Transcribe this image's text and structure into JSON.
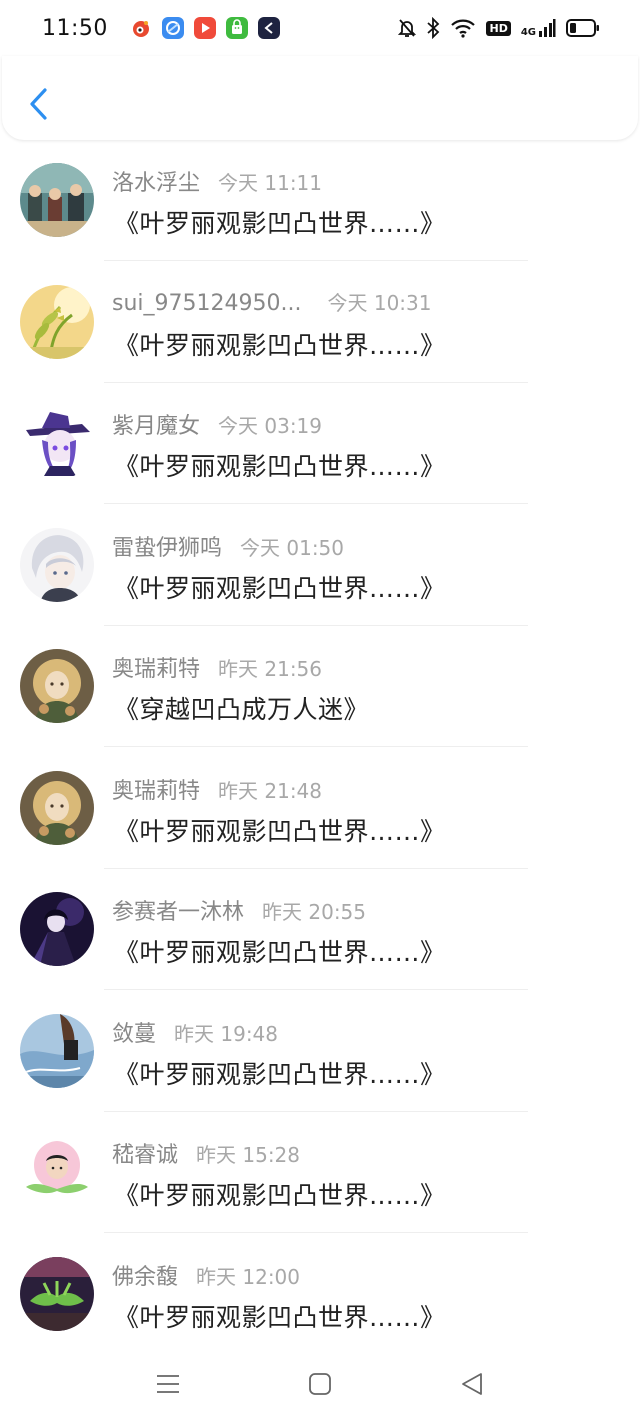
{
  "status_bar": {
    "time": "11:50",
    "notification_apps": [
      {
        "icon": "weibo-icon",
        "color": "#e8492f"
      },
      {
        "icon": "browser-icon",
        "color": "#3b8cf0"
      },
      {
        "icon": "video-icon",
        "color": "#f04a3a"
      },
      {
        "icon": "store-icon",
        "color": "#3fbb3f"
      },
      {
        "icon": "app-icon",
        "color": "#1e2340"
      }
    ],
    "hd_label": "HD",
    "network_label": "4G"
  },
  "header": {
    "back_icon": "chevron-left-icon",
    "accent": "#2d8ff0"
  },
  "messages": [
    {
      "name": "洛水浮尘",
      "time": "今天 11:11",
      "content": "《叶罗丽观影凹凸世界……》"
    },
    {
      "name": "sui_975124950...",
      "time": "今天 10:31",
      "content": "《叶罗丽观影凹凸世界……》"
    },
    {
      "name": "紫月魔女",
      "time": "今天 03:19",
      "content": "《叶罗丽观影凹凸世界……》"
    },
    {
      "name": "雷蛰伊狮鸣",
      "time": "今天 01:50",
      "content": "《叶罗丽观影凹凸世界……》"
    },
    {
      "name": "奥瑞莉特",
      "time": "昨天 21:56",
      "content": "《穿越凹凸成万人迷》"
    },
    {
      "name": "奥瑞莉特",
      "time": "昨天 21:48",
      "content": "《叶罗丽观影凹凸世界……》"
    },
    {
      "name": "参赛者一沐林",
      "time": "昨天 20:55",
      "content": "《叶罗丽观影凹凸世界……》"
    },
    {
      "name": "敛蔓",
      "time": "昨天 19:48",
      "content": "《叶罗丽观影凹凸世界……》"
    },
    {
      "name": "嵇睿诚",
      "time": "昨天 15:28",
      "content": "《叶罗丽观影凹凸世界……》"
    },
    {
      "name": "佛余馥",
      "time": "昨天 12:00",
      "content": "《叶罗丽观影凹凸世界……》"
    }
  ],
  "nav_bar": {
    "icons": [
      "menu-icon",
      "home-icon",
      "back-triangle-icon"
    ]
  }
}
